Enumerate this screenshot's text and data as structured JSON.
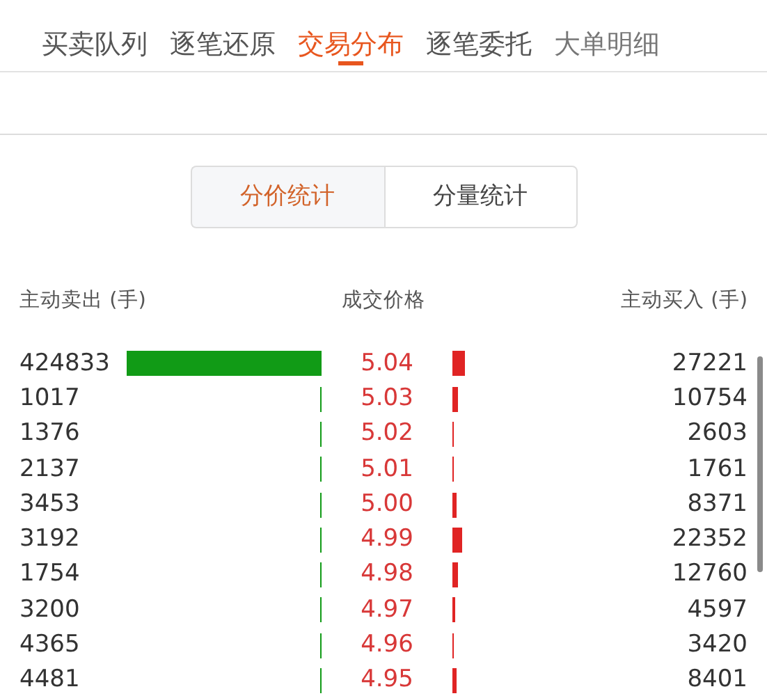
{
  "tabs": [
    {
      "label": "买卖队列",
      "selected": false
    },
    {
      "label": "逐笔还原",
      "selected": false
    },
    {
      "label": "交易分布",
      "selected": true
    },
    {
      "label": "逐笔委托",
      "selected": false
    },
    {
      "label": "大单明细",
      "selected": false
    }
  ],
  "segments": [
    {
      "label": "分价统计",
      "selected": true
    },
    {
      "label": "分量统计",
      "selected": false
    }
  ],
  "columns": [
    "主动卖出 (手)",
    "成交价格",
    "主动买入 (手)"
  ],
  "rows": [
    {
      "sell": "424833",
      "sell_bar": {
        "level": 1
      },
      "price": "5.04",
      "buy_bar": {
        "level": 0.064
      },
      "buy": "27221"
    },
    {
      "sell": "1017",
      "sell_bar": {
        "level": 0.0024
      },
      "price": "5.03",
      "buy_bar": {
        "level": 0.0253
      },
      "buy": "10754"
    },
    {
      "sell": "1376",
      "sell_bar": {
        "level": 0.0032
      },
      "price": "5.02",
      "buy_bar": {
        "level": 0.0061
      },
      "buy": "2603"
    },
    {
      "sell": "2137",
      "sell_bar": {
        "level": 0.005
      },
      "price": "5.01",
      "buy_bar": {
        "level": 0.0041
      },
      "buy": "1761"
    },
    {
      "sell": "3453",
      "sell_bar": {
        "level": 0.0081
      },
      "price": "5.00",
      "buy_bar": {
        "level": 0.0197
      },
      "buy": "8371"
    },
    {
      "sell": "3192",
      "sell_bar": {
        "level": 0.0075
      },
      "price": "4.99",
      "buy_bar": {
        "level": 0.0526
      },
      "buy": "22352"
    },
    {
      "sell": "1754",
      "sell_bar": {
        "level": 0.0041
      },
      "price": "4.98",
      "buy_bar": {
        "level": 0.03
      },
      "buy": "12760"
    },
    {
      "sell": "3200",
      "sell_bar": {
        "level": 0.0075
      },
      "price": "4.97",
      "buy_bar": {
        "level": 0.0108
      },
      "buy": "4597"
    },
    {
      "sell": "4365",
      "sell_bar": {
        "level": 0.0103
      },
      "price": "4.96",
      "buy_bar": {
        "level": 0.0081
      },
      "buy": "3420"
    },
    {
      "sell": "4481",
      "sell_bar": {
        "level": 0.0105
      },
      "price": "4.95",
      "buy_bar": {
        "level": 0.0198
      },
      "buy": "8401"
    }
  ]
}
